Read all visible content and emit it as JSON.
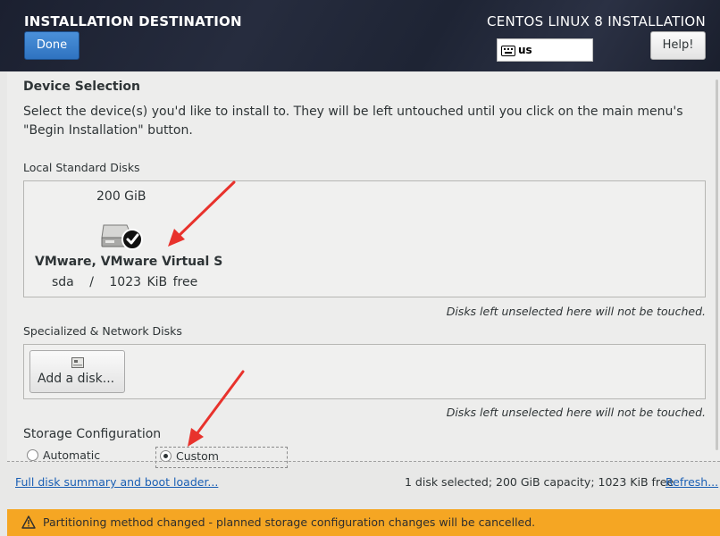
{
  "header": {
    "title": "INSTALLATION DESTINATION",
    "done_label": "Done",
    "product": "CENTOS LINUX 8 INSTALLATION",
    "keyboard_layout": "us",
    "help_label": "Help!"
  },
  "device_selection": {
    "heading": "Device Selection",
    "intro": "Select the device(s) you'd like to install to.  They will be left untouched until you click on the main menu's \"Begin Installation\" button."
  },
  "local_disks": {
    "heading": "Local Standard Disks",
    "disks": [
      {
        "capacity": "200 GiB",
        "name": "VMware, VMware Virtual S",
        "device": "sda",
        "separator": "/",
        "free": "1023 KiB free",
        "selected": true
      }
    ],
    "note": "Disks left unselected here will not be touched."
  },
  "specialized_disks": {
    "heading": "Specialized & Network Disks",
    "add_label": "Add a disk...",
    "note": "Disks left unselected here will not be touched."
  },
  "storage_config": {
    "heading": "Storage Configuration",
    "options": [
      {
        "label": "Automatic",
        "selected": false
      },
      {
        "label": "Custom",
        "selected": true
      }
    ]
  },
  "footer": {
    "summary_link": "Full disk summary and boot loader...",
    "summary_text": "1 disk selected; 200 GiB capacity; 1023 KiB free",
    "refresh_link": "Refresh..."
  },
  "warning": {
    "text": "Partitioning method changed - planned storage configuration changes will be cancelled."
  },
  "colors": {
    "accent": "#2f73c0",
    "warning": "#f5a623",
    "annotation_arrow": "#e8322c",
    "link": "#1a5fb4"
  }
}
